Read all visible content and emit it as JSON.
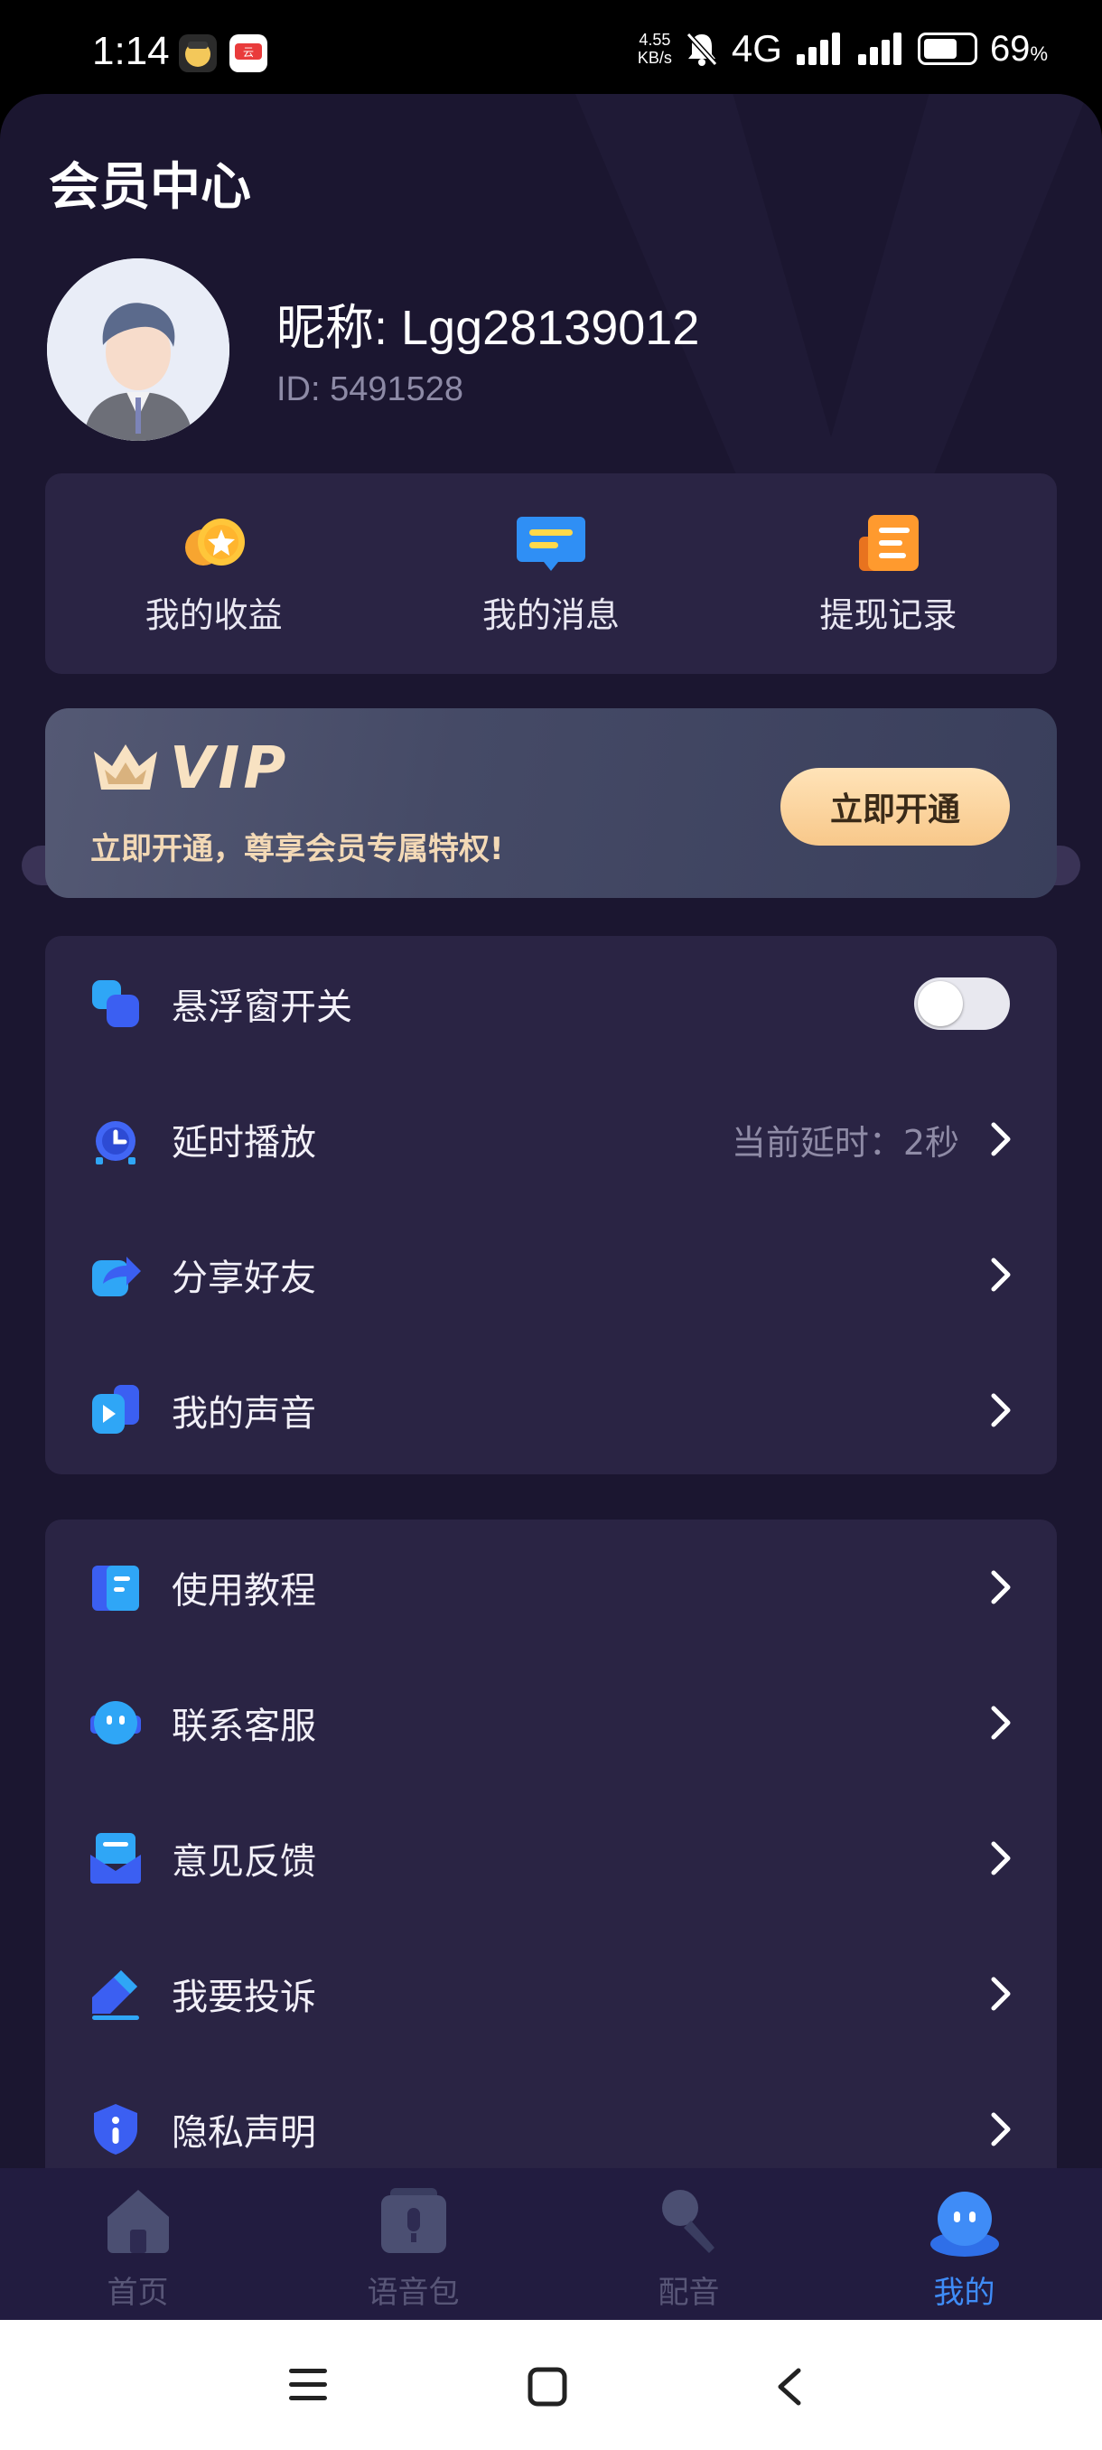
{
  "status_bar": {
    "time": "1:14",
    "net_speed_value": "4.55",
    "net_speed_unit": "KB/s",
    "network": "4G",
    "battery_percent": 69,
    "battery_text": "69",
    "battery_suffix": "%"
  },
  "page": {
    "title": "会员中心"
  },
  "profile": {
    "nickname": "昵称: Lgg28139012",
    "id_text": "ID: 5491528"
  },
  "quick_actions": [
    {
      "label": "我的收益",
      "icon": "coin-star-icon"
    },
    {
      "label": "我的消息",
      "icon": "message-bubble-icon"
    },
    {
      "label": "提现记录",
      "icon": "record-doc-icon"
    }
  ],
  "vip": {
    "title": "VIP",
    "subtitle": "立即开通，尊享会员专属特权!",
    "button": "立即开通"
  },
  "settings_group_1": [
    {
      "label": "悬浮窗开关",
      "icon": "floating-window-icon",
      "toggle": false
    },
    {
      "label": "延时播放",
      "icon": "alarm-clock-icon",
      "value": "当前延时：2秒"
    },
    {
      "label": "分享好友",
      "icon": "share-icon"
    },
    {
      "label": "我的声音",
      "icon": "voice-play-icon"
    }
  ],
  "settings_group_2": [
    {
      "label": "使用教程",
      "icon": "book-icon"
    },
    {
      "label": "联系客服",
      "icon": "customer-service-icon"
    },
    {
      "label": "意见反馈",
      "icon": "feedback-mail-icon"
    },
    {
      "label": "我要投诉",
      "icon": "complaint-pen-icon"
    },
    {
      "label": "隐私声明",
      "icon": "privacy-shield-icon"
    }
  ],
  "tabs": [
    {
      "label": "首页",
      "icon": "home-icon",
      "active": false
    },
    {
      "label": "语音包",
      "icon": "voice-pack-icon",
      "active": false
    },
    {
      "label": "配音",
      "icon": "microphone-icon",
      "active": false
    },
    {
      "label": "我的",
      "icon": "profile-ghost-icon",
      "active": true
    }
  ],
  "colors": {
    "background": "#1b1630",
    "card": "#2a2444",
    "accent": "#3f8cf7",
    "vip_gold": "#f8e2c2"
  }
}
